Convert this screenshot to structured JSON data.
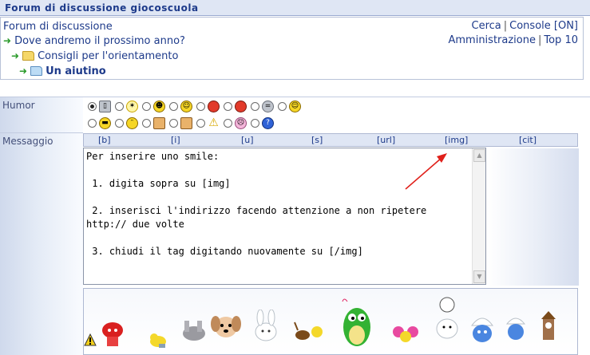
{
  "header": {
    "title": "Forum di discussione giocoscuola"
  },
  "breadcrumb": [
    {
      "label": "Forum di discussione",
      "icon": "none"
    },
    {
      "label": "Dove andremo il prossimo anno?",
      "icon": "arrow-icon"
    },
    {
      "label": "Consigli per l'orientamento",
      "icon": "folder-icon"
    },
    {
      "label": "Un aiutino",
      "icon": "open-folder-icon"
    }
  ],
  "top_links": {
    "cerca": "Cerca",
    "console": "Console [ON]",
    "amministrazione": "Amministrazione",
    "top10": "Top 10",
    "separator": "|"
  },
  "form": {
    "humor_label": "Humor",
    "message_label": "Messaggio",
    "humor_options_row1": [
      "phone-icon",
      "lightbulb-icon",
      "grin-icon",
      "smile-icon",
      "angry-icon",
      "mad-icon",
      "cool-icon",
      "happy-icon"
    ],
    "humor_options_row2": [
      "sunglasses-icon",
      "tongue-icon",
      "thumbs-up-icon",
      "thumbs-down-icon",
      "warning-icon",
      "sad-icon",
      "question-icon"
    ],
    "selected_humor": "phone-icon",
    "tags": [
      "[b]",
      "[i]",
      "[u]",
      "[s]",
      "[url]",
      "[img]",
      "[cit]"
    ],
    "message_text": "Per inserire uno smile:\n\n 1. digita sopra su [img]\n\n 2. inserisci l'indirizzo facendo attenzione a non ripetere http:// due volte\n\n 3. chiudi il tag digitando nuovamente su [/img]"
  },
  "colors": {
    "link": "#1d3a8a",
    "title_bar": "#dfe6f4",
    "arrow": "#e0201a",
    "nav_arrow": "#2a9a2a"
  },
  "gallery": {
    "items": [
      "warning-sign-icon",
      "red-mushroom-icon",
      "duck-icon",
      "donkey-icon",
      "puppy-icon",
      "bunny-icon",
      "reindeer-icon",
      "green-dragon-icon",
      "pompom-icon",
      "snowman-icon",
      "smurf-icon",
      "clock-tower-icon"
    ]
  }
}
